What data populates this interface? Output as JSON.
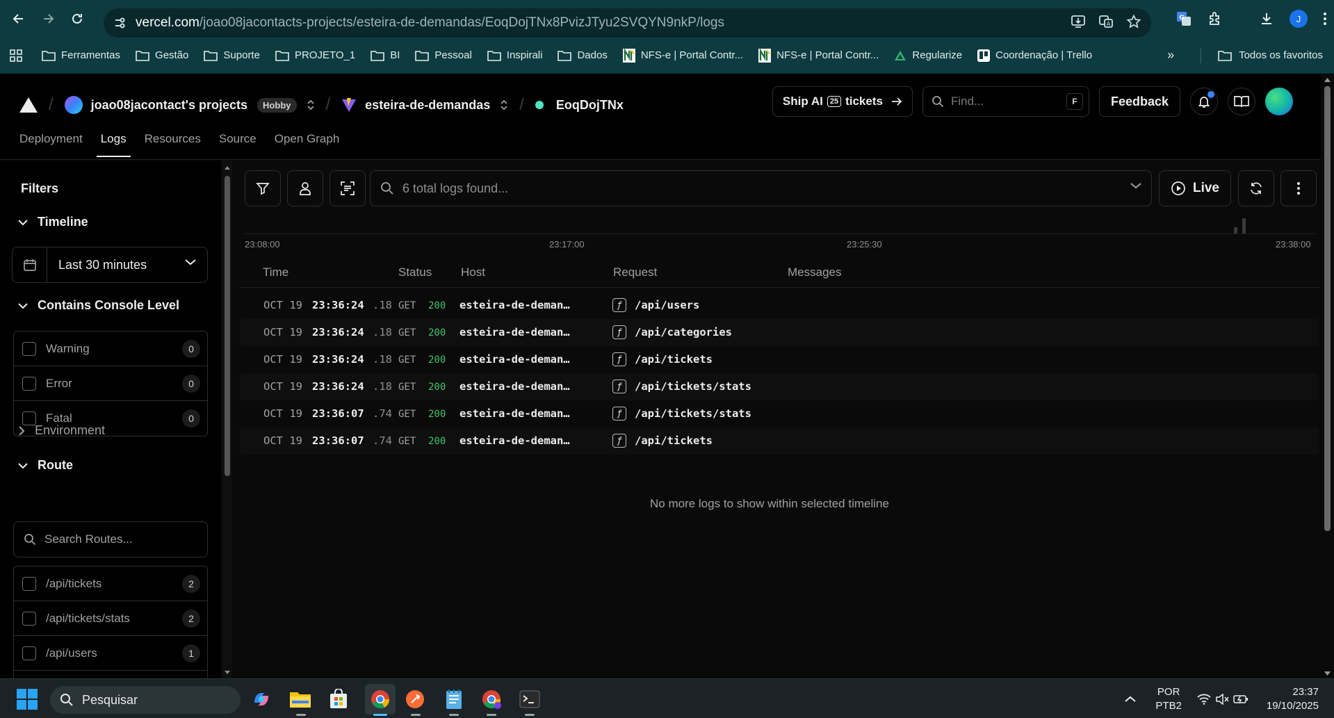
{
  "browser": {
    "url_host": "vercel.com",
    "url_path": "/joao08jacontacts-projects/esteira-de-demandas/EoqDojTNx8PvizJTyu2SVQYN9nkP/logs",
    "profile_initial": "J"
  },
  "bookmarks": [
    {
      "label": "Ferramentas",
      "icon": "folder-icon"
    },
    {
      "label": "Gestão",
      "icon": "folder-icon"
    },
    {
      "label": "Suporte",
      "icon": "folder-icon"
    },
    {
      "label": "PROJETO_1",
      "icon": "folder-icon"
    },
    {
      "label": "BI",
      "icon": "folder-icon"
    },
    {
      "label": "Pessoal",
      "icon": "folder-icon"
    },
    {
      "label": "Inspirali",
      "icon": "folder-icon"
    },
    {
      "label": "Dados",
      "icon": "folder-icon"
    },
    {
      "label": "NFS-e | Portal Contr...",
      "icon": "nfse-icon"
    },
    {
      "label": "NFS-e | Portal Contr...",
      "icon": "nfse-icon"
    },
    {
      "label": "Regularize",
      "icon": "regularize-icon"
    },
    {
      "label": "Coordenação | Trello",
      "icon": "trello-icon"
    }
  ],
  "bookmarks_all": "Todos os favoritos",
  "header": {
    "team": "joao08jacontact's projects",
    "plan_badge": "Hobby",
    "project": "esteira-de-demandas",
    "deployment": "EoqDojTNx",
    "ship_prefix": "Ship AI",
    "ship_count": "25",
    "ship_suffix": "tickets",
    "find_placeholder": "Find...",
    "find_shortcut": "F",
    "feedback": "Feedback"
  },
  "tabs": [
    "Deployment",
    "Logs",
    "Resources",
    "Source",
    "Open Graph"
  ],
  "active_tab": "Logs",
  "filters": {
    "title": "Filters",
    "timeline_label": "Timeline",
    "timeline_value": "Last 30 minutes",
    "console_label": "Contains Console Level",
    "levels": [
      {
        "label": "Warning",
        "count": "0"
      },
      {
        "label": "Error",
        "count": "0"
      },
      {
        "label": "Fatal",
        "count": "0"
      }
    ],
    "environment_label": "Environment",
    "route_label": "Route",
    "route_search_placeholder": "Search Routes...",
    "routes": [
      {
        "label": "/api/tickets",
        "count": "2"
      },
      {
        "label": "/api/tickets/stats",
        "count": "2"
      },
      {
        "label": "/api/users",
        "count": "1"
      }
    ]
  },
  "logs_toolbar": {
    "search_placeholder": "6 total logs found...",
    "live_label": "Live"
  },
  "histogram": {
    "ticks": [
      "23:08:00",
      "23:17:00",
      "23:25:30",
      "23:38:00"
    ]
  },
  "table": {
    "columns": [
      "Time",
      "Status",
      "Host",
      "Request",
      "Messages"
    ],
    "rows": [
      {
        "date": "OCT 19",
        "time": "23:36:24",
        "ms": ".18",
        "method": "GET",
        "status": "200",
        "host": "esteira-de-deman…",
        "path": "/api/users"
      },
      {
        "date": "OCT 19",
        "time": "23:36:24",
        "ms": ".18",
        "method": "GET",
        "status": "200",
        "host": "esteira-de-deman…",
        "path": "/api/categories"
      },
      {
        "date": "OCT 19",
        "time": "23:36:24",
        "ms": ".18",
        "method": "GET",
        "status": "200",
        "host": "esteira-de-deman…",
        "path": "/api/tickets"
      },
      {
        "date": "OCT 19",
        "time": "23:36:24",
        "ms": ".18",
        "method": "GET",
        "status": "200",
        "host": "esteira-de-deman…",
        "path": "/api/tickets/stats"
      },
      {
        "date": "OCT 19",
        "time": "23:36:07",
        "ms": ".74",
        "method": "GET",
        "status": "200",
        "host": "esteira-de-deman…",
        "path": "/api/tickets/stats"
      },
      {
        "date": "OCT 19",
        "time": "23:36:07",
        "ms": ".74",
        "method": "GET",
        "status": "200",
        "host": "esteira-de-deman…",
        "path": "/api/tickets"
      }
    ],
    "function_glyph": "ƒ",
    "empty_message": "No more logs to show within selected timeline"
  },
  "taskbar": {
    "search_label": "Pesquisar",
    "lang_top": "POR",
    "lang_bottom": "PTB2",
    "time": "23:37",
    "date": "19/10/2025"
  },
  "colors": {
    "status_ok": "#45c46b",
    "chrome_bg": "#0d3b40",
    "accent": "#3b82f6"
  }
}
